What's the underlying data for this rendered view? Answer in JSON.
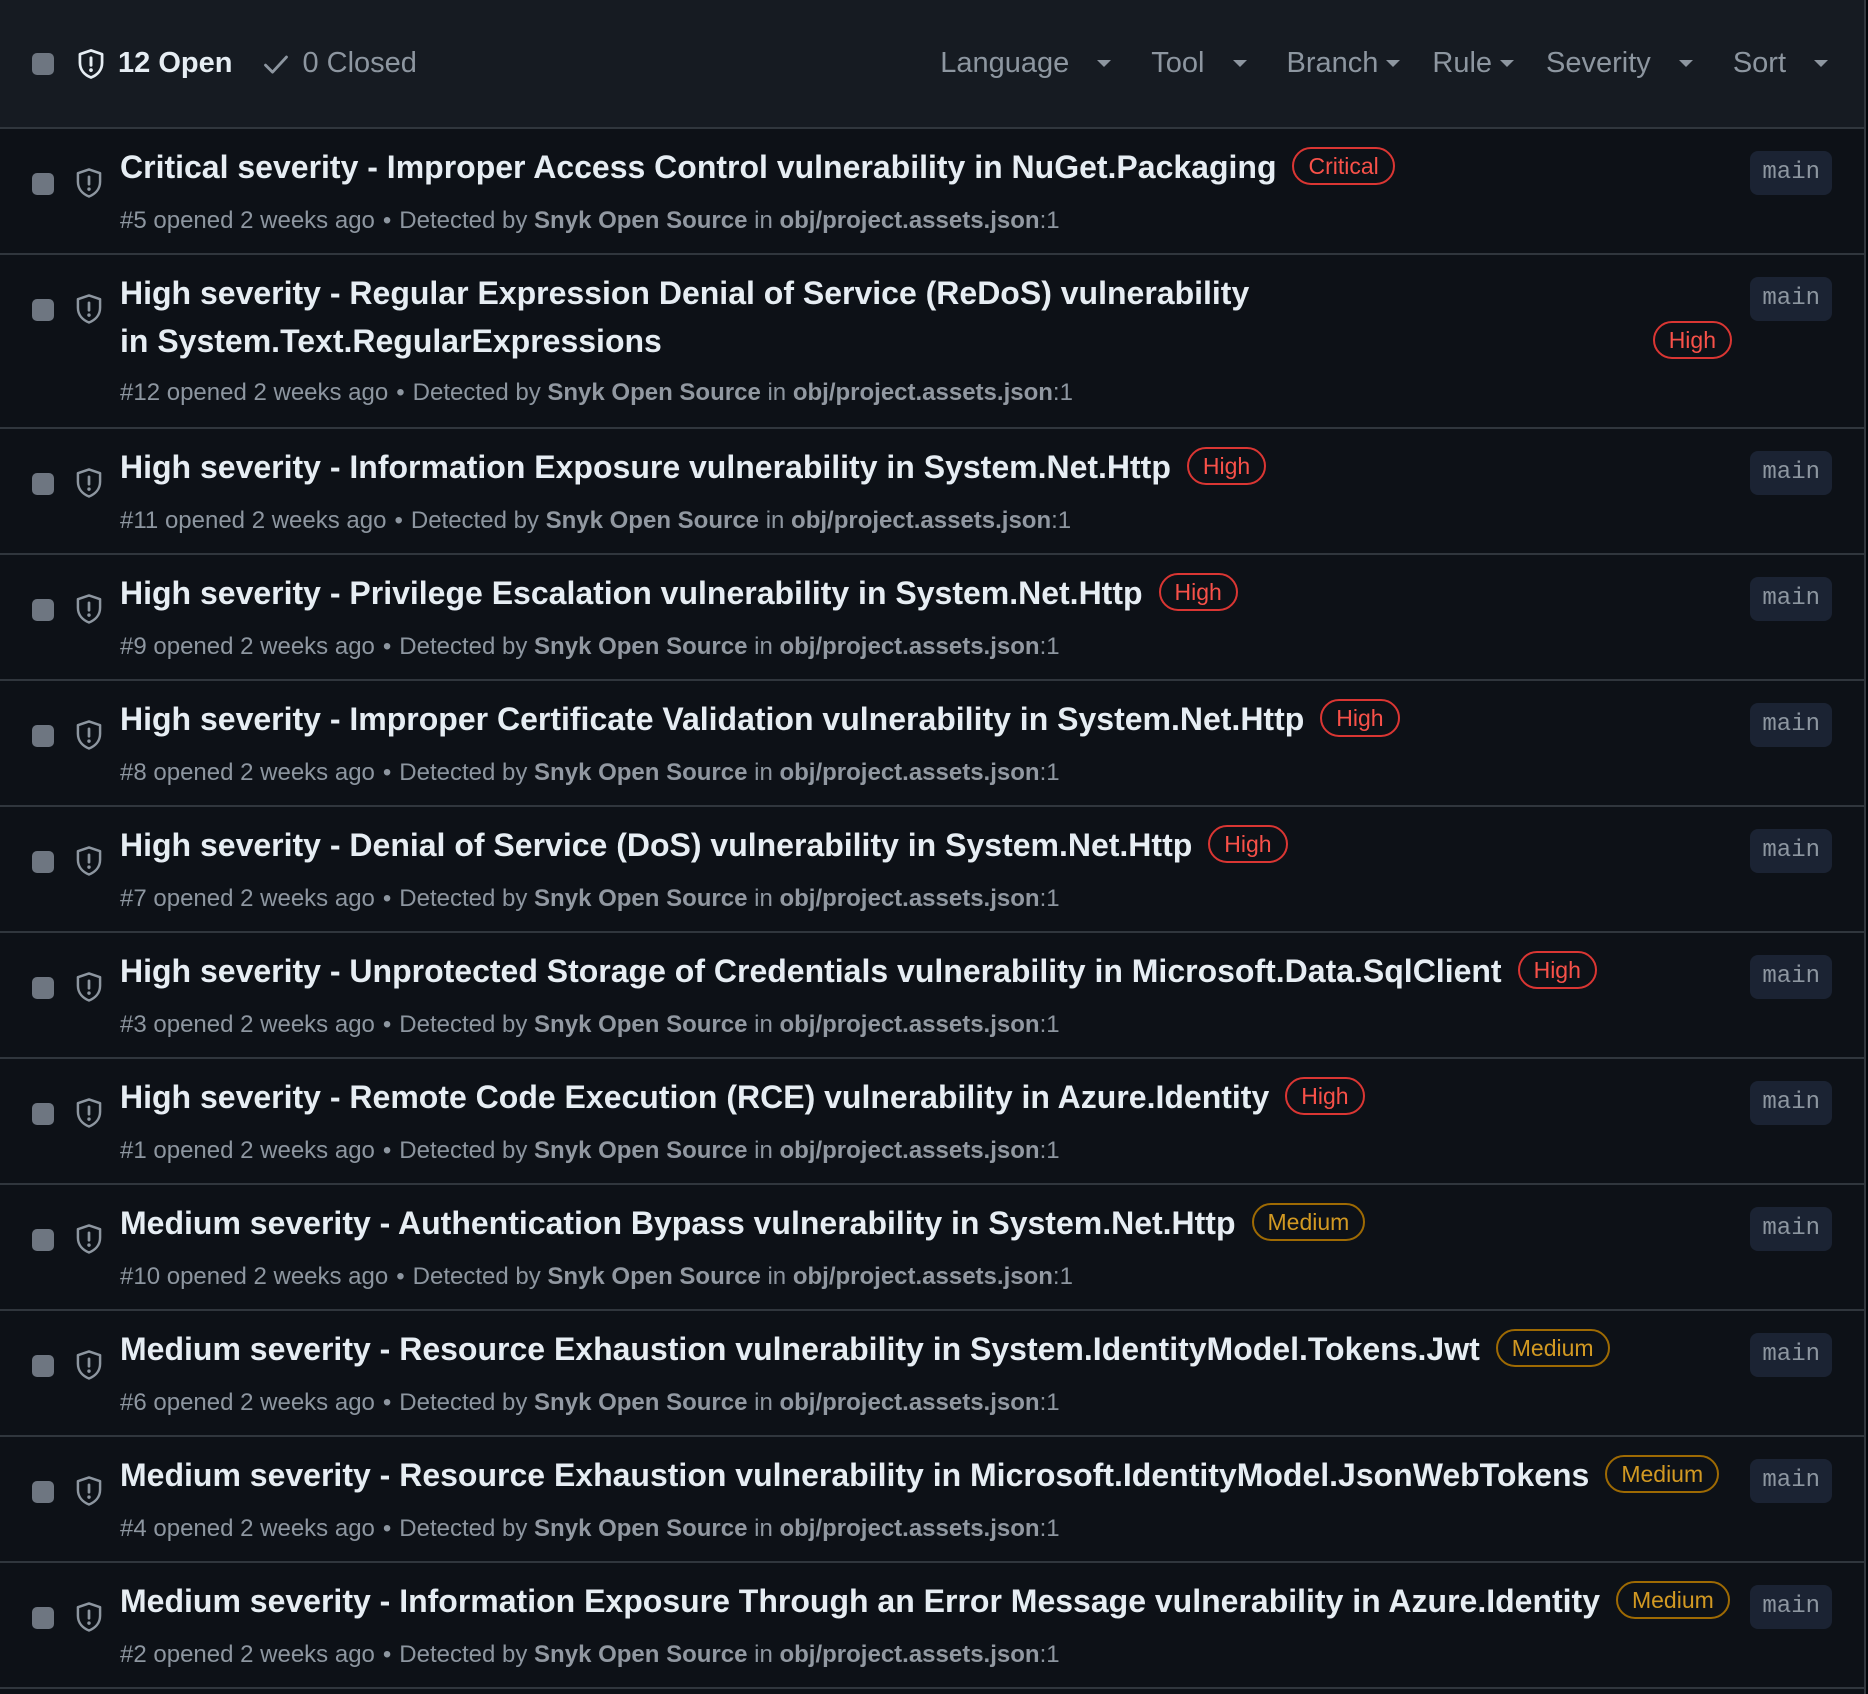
{
  "header": {
    "open_label": "12 Open",
    "closed_label": "0 Closed",
    "filters": [
      "Language",
      "Tool",
      "Branch",
      "Rule",
      "Severity",
      "Sort"
    ]
  },
  "colors": {
    "critical": "#f85149",
    "high": "#f85149",
    "medium": "#d29922"
  },
  "alerts": [
    {
      "title": "Critical severity - Improper Access Control vulnerability in NuGet.Packaging",
      "severity": "Critical",
      "level": "crit",
      "number": "#5",
      "opened": "opened 2 weeks ago",
      "detected": "Detected by",
      "tool": "Snyk Open Source",
      "in": "in",
      "file": "obj/project.assets.json",
      "line": ":1",
      "branch": "main"
    },
    {
      "title": "High severity - Regular Expression Denial of Service (ReDoS) vulnerability in System.Text.RegularExpressions",
      "severity": "High",
      "level": "high",
      "number": "#12",
      "opened": "opened 2 weeks ago",
      "detected": "Detected by",
      "tool": "Snyk Open Source",
      "in": "in",
      "file": "obj/project.assets.json",
      "line": ":1",
      "branch": "main"
    },
    {
      "title": "High severity - Information Exposure vulnerability in System.Net.Http",
      "severity": "High",
      "level": "high",
      "number": "#11",
      "opened": "opened 2 weeks ago",
      "detected": "Detected by",
      "tool": "Snyk Open Source",
      "in": "in",
      "file": "obj/project.assets.json",
      "line": ":1",
      "branch": "main"
    },
    {
      "title": "High severity - Privilege Escalation vulnerability in System.Net.Http",
      "severity": "High",
      "level": "high",
      "number": "#9",
      "opened": "opened 2 weeks ago",
      "detected": "Detected by",
      "tool": "Snyk Open Source",
      "in": "in",
      "file": "obj/project.assets.json",
      "line": ":1",
      "branch": "main"
    },
    {
      "title": "High severity - Improper Certificate Validation vulnerability in System.Net.Http",
      "severity": "High",
      "level": "high",
      "number": "#8",
      "opened": "opened 2 weeks ago",
      "detected": "Detected by",
      "tool": "Snyk Open Source",
      "in": "in",
      "file": "obj/project.assets.json",
      "line": ":1",
      "branch": "main"
    },
    {
      "title": "High severity - Denial of Service (DoS) vulnerability in System.Net.Http",
      "severity": "High",
      "level": "high",
      "number": "#7",
      "opened": "opened 2 weeks ago",
      "detected": "Detected by",
      "tool": "Snyk Open Source",
      "in": "in",
      "file": "obj/project.assets.json",
      "line": ":1",
      "branch": "main"
    },
    {
      "title": "High severity - Unprotected Storage of Credentials vulnerability in Microsoft.Data.SqlClient",
      "severity": "High",
      "level": "high",
      "number": "#3",
      "opened": "opened 2 weeks ago",
      "detected": "Detected by",
      "tool": "Snyk Open Source",
      "in": "in",
      "file": "obj/project.assets.json",
      "line": ":1",
      "branch": "main"
    },
    {
      "title": "High severity - Remote Code Execution (RCE) vulnerability in Azure.Identity",
      "severity": "High",
      "level": "high",
      "number": "#1",
      "opened": "opened 2 weeks ago",
      "detected": "Detected by",
      "tool": "Snyk Open Source",
      "in": "in",
      "file": "obj/project.assets.json",
      "line": ":1",
      "branch": "main"
    },
    {
      "title": "Medium severity - Authentication Bypass vulnerability in System.Net.Http",
      "severity": "Medium",
      "level": "med",
      "number": "#10",
      "opened": "opened 2 weeks ago",
      "detected": "Detected by",
      "tool": "Snyk Open Source",
      "in": "in",
      "file": "obj/project.assets.json",
      "line": ":1",
      "branch": "main"
    },
    {
      "title": "Medium severity - Resource Exhaustion vulnerability in System.IdentityModel.Tokens.Jwt",
      "severity": "Medium",
      "level": "med",
      "number": "#6",
      "opened": "opened 2 weeks ago",
      "detected": "Detected by",
      "tool": "Snyk Open Source",
      "in": "in",
      "file": "obj/project.assets.json",
      "line": ":1",
      "branch": "main"
    },
    {
      "title": "Medium severity - Resource Exhaustion vulnerability in Microsoft.IdentityModel.JsonWebTokens",
      "severity": "Medium",
      "level": "med",
      "number": "#4",
      "opened": "opened 2 weeks ago",
      "detected": "Detected by",
      "tool": "Snyk Open Source",
      "in": "in",
      "file": "obj/project.assets.json",
      "line": ":1",
      "branch": "main"
    },
    {
      "title": "Medium severity - Information Exposure Through an Error Message vulnerability in Azure.Identity",
      "severity": "Medium",
      "level": "med",
      "number": "#2",
      "opened": "opened 2 weeks ago",
      "detected": "Detected by",
      "tool": "Snyk Open Source",
      "in": "in",
      "file": "obj/project.assets.json",
      "line": ":1",
      "branch": "main"
    }
  ]
}
